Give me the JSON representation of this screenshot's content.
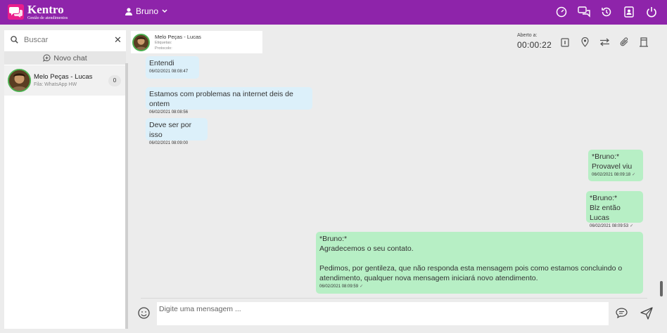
{
  "app": {
    "brand_name": "Kentro",
    "brand_subtitle": "Gestão de atendimentos",
    "brand_color": "#8e24aa",
    "logo_color": "#e91e8c"
  },
  "topbar": {
    "user_name": "Bruno",
    "user_icon": "user-icon",
    "icons": [
      "dashboard-icon",
      "chats-icon",
      "history-icon",
      "contacts-icon",
      "power-icon"
    ]
  },
  "sidebar": {
    "search_placeholder": "Buscar",
    "new_chat_label": "Novo chat",
    "chats": [
      {
        "name": "Melo Peças - Lucas",
        "queue": "Fila: WhatsApp HW",
        "unread": "0"
      }
    ]
  },
  "chat_header": {
    "contact_name": "Melo Peças - Lucas",
    "tags_label": "Etiquetas:",
    "protocol_label": "Protocolo:",
    "opened_label": "Aberto a:",
    "opened_time": "00:00:22",
    "actions": [
      "info-icon",
      "location-icon",
      "transfer-icon",
      "attach-icon",
      "finish-icon"
    ]
  },
  "messages": [
    {
      "dir": "in",
      "text": "Entendi",
      "time": "06/02/2021 08:08:47"
    },
    {
      "dir": "in",
      "text": "Estamos com problemas na internet deis de ontem",
      "time": "06/02/2021 08:08:56"
    },
    {
      "dir": "in",
      "text": "Deve ser por isso",
      "time": "06/02/2021 08:09:00"
    },
    {
      "dir": "out",
      "text": "*Bruno:*\nProvavel viu",
      "time": "06/02/2021 08:09:18"
    },
    {
      "dir": "out",
      "text": "*Bruno:*\nBlz então Lucas",
      "time": "06/02/2021 08:09:53"
    },
    {
      "dir": "out",
      "text": "*Bruno:*\nAgradecemos o seu contato.\n\nPedimos, por gentileza, que não responda esta mensagem pois como estamos concluindo o\natendimento, qualquer nova mensagem iniciará novo atendimento.",
      "time": "06/02/2021 08:09:59"
    }
  ],
  "composer": {
    "placeholder": "Digite uma mensagem ...",
    "emoji_icon": "emoji-icon",
    "quick_reply_icon": "quick-reply-icon",
    "send_icon": "send-icon"
  },
  "colors": {
    "incoming_bubble": "#dcf0fa",
    "outgoing_bubble": "#b7efc5",
    "online_ring": "#4caf50"
  }
}
